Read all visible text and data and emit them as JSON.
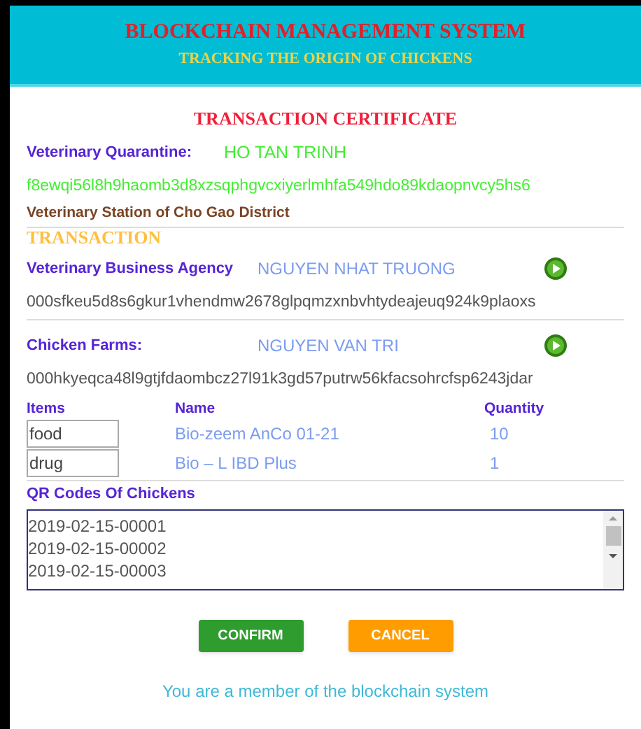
{
  "header": {
    "title": "BLOCKCHAIN MANAGEMENT SYSTEM",
    "subtitle": "TRACKING THE ORIGIN OF CHICKENS"
  },
  "certificate_title": "TRANSACTION CERTIFICATE",
  "quarantine": {
    "label": "Veterinary Quarantine:",
    "name": "HO TAN TRINH",
    "hash": "f8ewqi56l8h9haomb3d8xzsqphgvcxiyerlmhfa549hdo89kdaopnvcy5hs6",
    "station": "Veterinary Station of Cho Gao District"
  },
  "section_title": "TRANSACTION",
  "parties": [
    {
      "label": "Veterinary Business Agency",
      "name": "NGUYEN NHAT TRUONG",
      "hash": "000sfkeu5d8s6gkur1vhendmw2678glpqmzxnbvhtydeajeuq924k9plaoxs"
    },
    {
      "label": "Chicken Farms:",
      "name": "NGUYEN VAN TRI",
      "hash": "000hkyeqca48l9gtjfdaombcz27l91k3gd57putrw56kfacsohrcfsp6243jdar"
    }
  ],
  "items_table": {
    "columns": [
      "Items",
      "Name",
      "Quantity"
    ],
    "rows": [
      {
        "item": "food",
        "name": "Bio-zeem AnCo 01-21",
        "quantity": "10"
      },
      {
        "item": "drug",
        "name": "Bio – L IBD Plus",
        "quantity": "1"
      }
    ]
  },
  "qr_codes": {
    "label": "QR Codes Of Chickens",
    "lines": [
      "2019-02-15-00001",
      "2019-02-15-00002",
      "2019-02-15-00003"
    ]
  },
  "buttons": [
    {
      "label": "CONFIRM",
      "kind": "confirm"
    },
    {
      "label": "CANCEL",
      "kind": "cancel"
    }
  ],
  "footer": "You are a member of the blockchain system"
}
